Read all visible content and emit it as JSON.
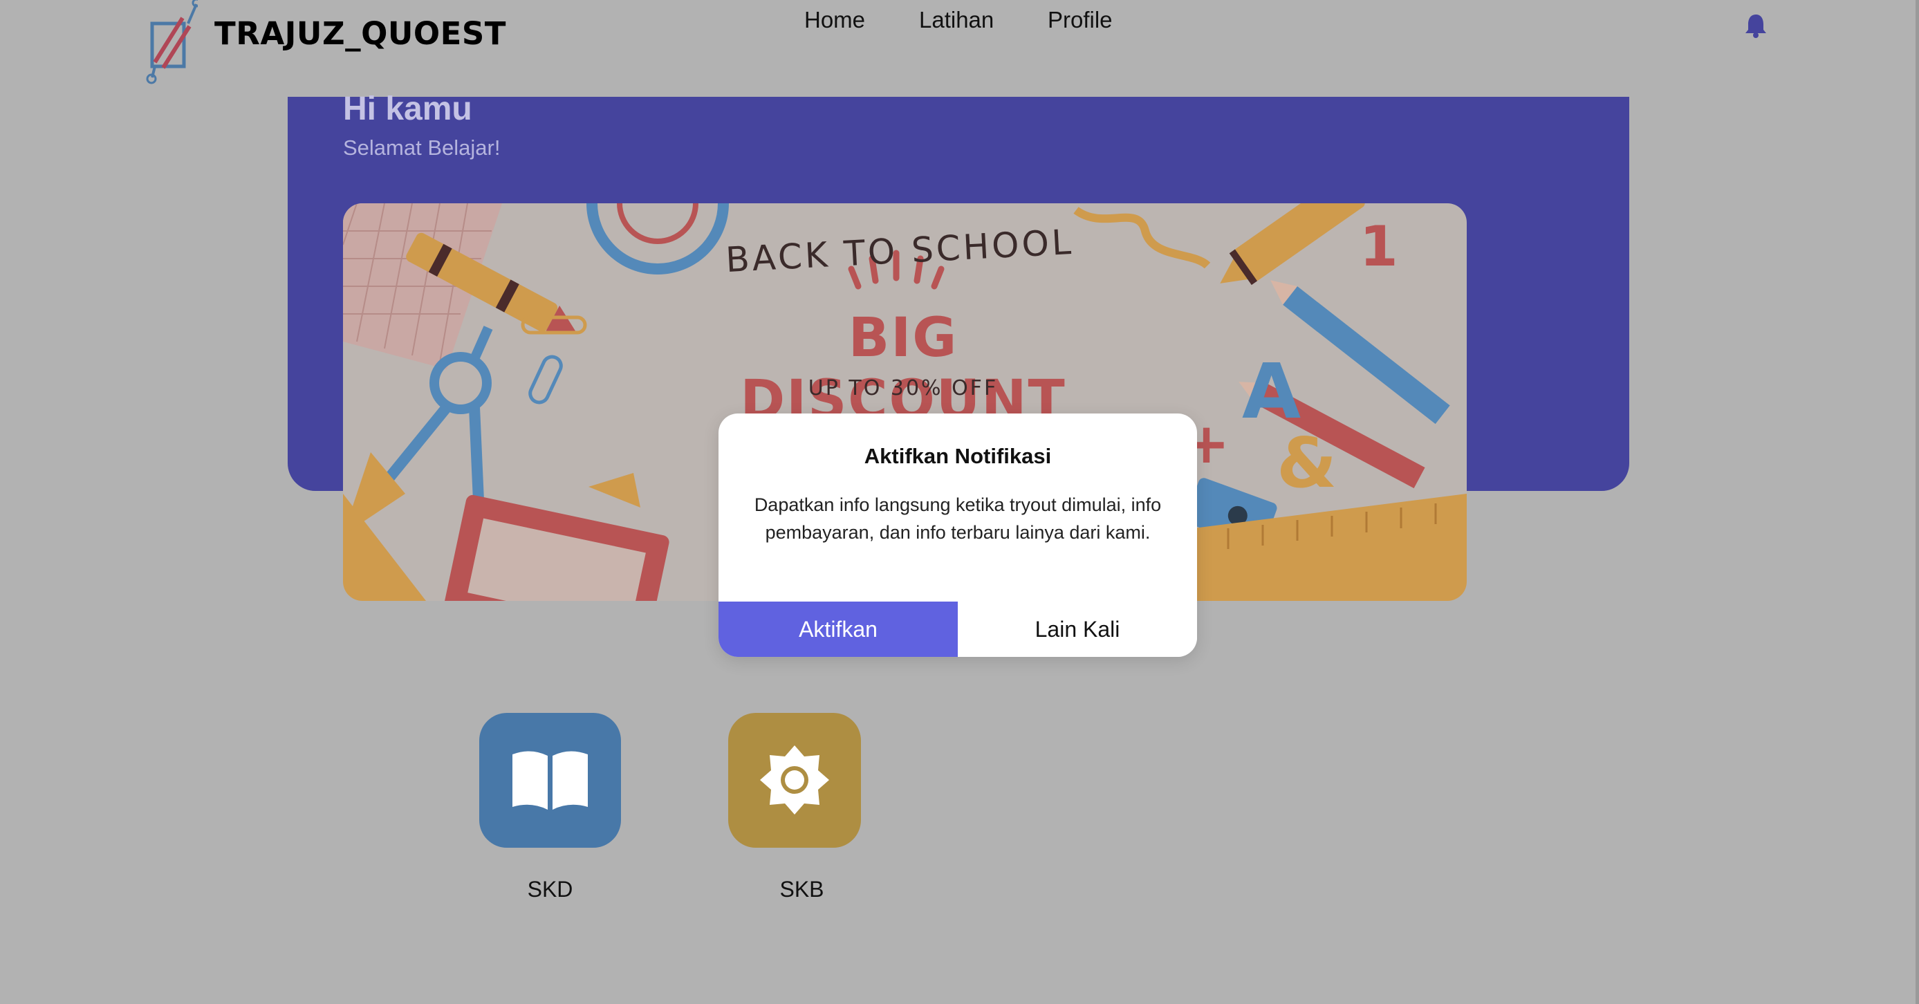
{
  "header": {
    "brand": "TRAJUZ_QUOEST",
    "nav": [
      {
        "label": "Home"
      },
      {
        "label": "Latihan"
      },
      {
        "label": "Profile"
      }
    ],
    "notification_icon": "bell-icon"
  },
  "hero": {
    "greeting": "Hi kamu",
    "subtitle": "Selamat Belajar!"
  },
  "banner": {
    "headline_top": "BACK TO SCHOOL",
    "headline_main": "BIG DISCOUNT",
    "headline_sub": "UP TO 30% OFF"
  },
  "categories": [
    {
      "label": "SKD",
      "icon": "open-book-icon",
      "color": "#4878a8"
    },
    {
      "label": "SKB",
      "icon": "gear-icon",
      "color": "#ae8e42"
    }
  ],
  "dialog": {
    "title": "Aktifkan Notifikasi",
    "body": "Dapatkan info langsung ketika tryout dimulai, info pembayaran, dan info terbaru lainya dari kami.",
    "primary_label": "Aktifkan",
    "secondary_label": "Lain Kali"
  },
  "colors": {
    "overlay_bg": "#b2b2b2",
    "hero": "#45449d",
    "primary": "#6062e0"
  }
}
